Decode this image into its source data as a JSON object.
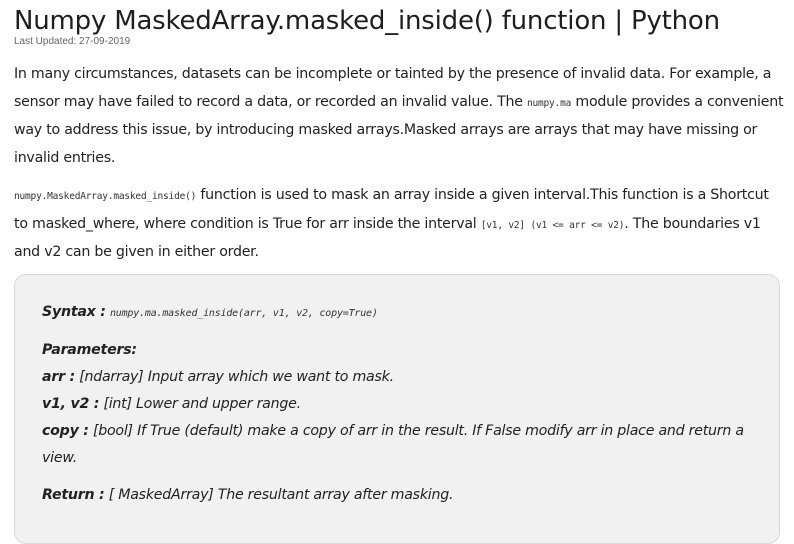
{
  "article": {
    "title": "Numpy MaskedArray.masked_inside() function | Python",
    "last_updated": "Last Updated: 27-09-2019",
    "para1": {
      "text_a": "In many circumstances, datasets can be incomplete or tainted by the presence of invalid data. For example, a sensor may have failed to record a data, or recorded an invalid value. The ",
      "code": "numpy.ma",
      "text_b": " module provides a convenient way to address this issue, by introducing masked arrays.Masked arrays are arrays that may have missing or invalid entries."
    },
    "para2": {
      "code_a": "numpy.MaskedArray.masked_inside()",
      "text_a": " function is used to mask an array inside a given interval.This function is a Shortcut to masked_where, where condition is True for arr inside the interval ",
      "code_b": "[v1, v2] (v1 <= arr <= v2)",
      "text_b": ". The boundaries v1 and v2 can be given in either order."
    }
  },
  "syntax_box": {
    "syntax_label": "Syntax :",
    "syntax_code": "numpy.ma.masked_inside(arr, v1, v2, copy=True)",
    "parameters_label": "Parameters:",
    "params": [
      {
        "name": "arr :",
        "desc": "[ndarray] Input array which we want to mask."
      },
      {
        "name": "v1, v2 :",
        "desc": "[int] Lower and upper range."
      },
      {
        "name": "copy :",
        "desc": "[bool] If True (default) make a copy of arr in the result. If False modify arr in place and return a view."
      }
    ],
    "return_label": "Return :",
    "return_desc": "[ MaskedArray] The resultant array after masking."
  }
}
